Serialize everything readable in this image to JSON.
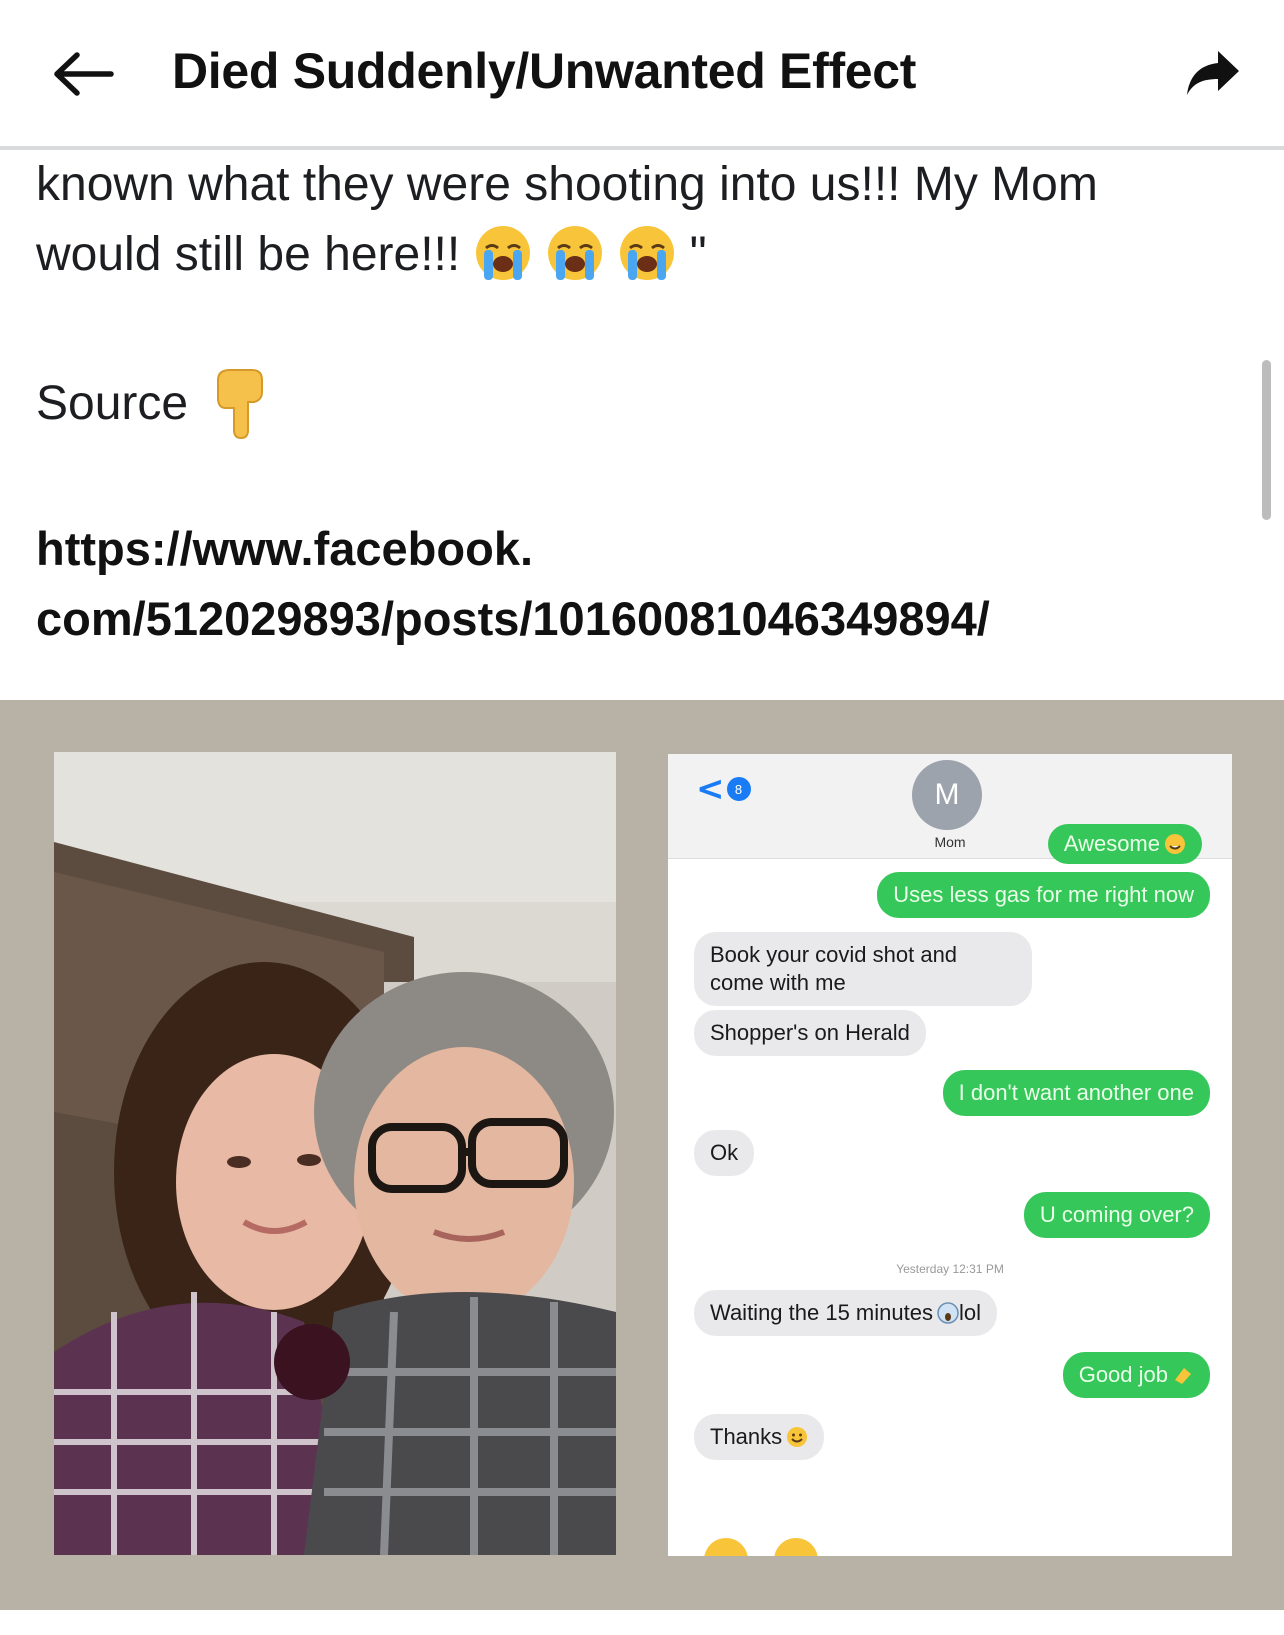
{
  "header": {
    "title": "Died Suddenly/Unwanted Effect",
    "back_icon": "left-arrow-icon",
    "share_icon": "share-arrow-icon"
  },
  "post": {
    "line1": "known what they were shooting into us!!! My Mom",
    "line2": "would still be here!!!",
    "line2_end": "\"",
    "crying_emoji": "loudly-crying-face-emoji",
    "source_label": "Source",
    "source_emoji": "backhand-index-pointing-down-emoji",
    "link_line1": "https://www.facebook.",
    "link_line2": "com/512029893/posts/10160081046349894/"
  },
  "attachment": {
    "photo_description_icon": "selfie-photo",
    "chat": {
      "contact_initial": "M",
      "contact_name": "Mom",
      "back_badge": "8",
      "messages": [
        {
          "dir": "out",
          "text": "Awesome",
          "emoji": "grinning-sweat-emoji"
        },
        {
          "dir": "out",
          "text": "Uses less gas for me right now"
        },
        {
          "dir": "in",
          "text": "Book your covid shot and come with me"
        },
        {
          "dir": "in",
          "text": "Shopper's on Herald"
        },
        {
          "dir": "out",
          "text": "I don't want another one"
        },
        {
          "dir": "in",
          "text": "Ok"
        },
        {
          "dir": "out",
          "text": "U coming over?"
        },
        {
          "dir": "in",
          "text": "Waiting the 15 minutes",
          "emoji": "screaming-face-emoji",
          "suffix": "lol"
        },
        {
          "dir": "out",
          "text": "Good job",
          "emoji": "clapping-hands-emoji"
        },
        {
          "dir": "in",
          "text": "Thanks",
          "emoji": "smiling-face-emoji"
        }
      ],
      "timestamp": "Yesterday 12:31 PM"
    }
  },
  "colors": {
    "imessage_green": "#35c759",
    "received_gray": "#e9e9eb",
    "frame_taupe": "#b7b1a6"
  }
}
